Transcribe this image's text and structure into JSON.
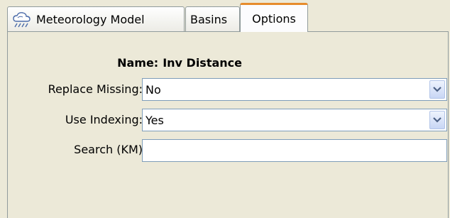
{
  "tabs": [
    {
      "label": "Meteorology Model",
      "icon": "weather-icon"
    },
    {
      "label": "Basins"
    },
    {
      "label": "Options",
      "active": true
    }
  ],
  "form": {
    "name_label": "Name:",
    "name_value": "Inv Distance",
    "replace_missing": {
      "label": "Replace Missing:",
      "value": "No"
    },
    "use_indexing": {
      "label": "Use Indexing:",
      "value": "Yes"
    },
    "search": {
      "label": "Search (KM)",
      "value": ""
    }
  },
  "colors": {
    "active_tab_accent": "#e68b2c",
    "panel_bg": "#ece9d8",
    "field_border": "#7f9db9"
  }
}
